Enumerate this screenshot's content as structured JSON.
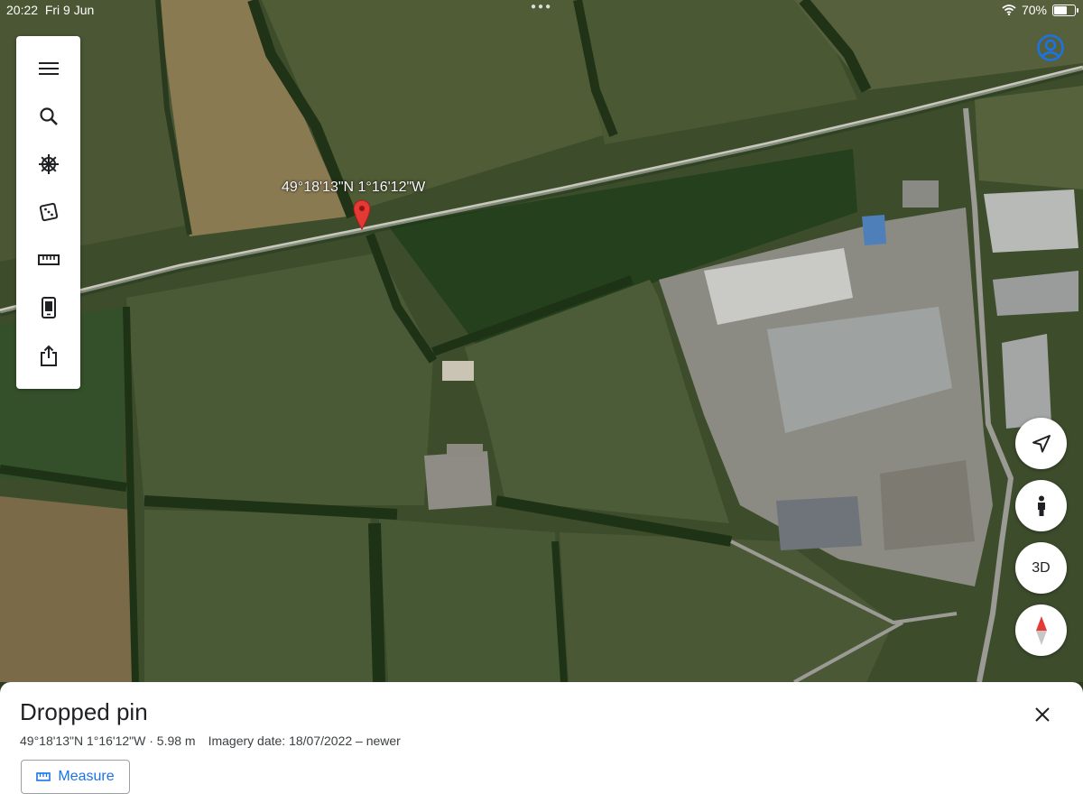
{
  "status": {
    "time": "20:22",
    "date": "Fri 9 Jun",
    "battery_pct": "70%",
    "battery_level": 0.7,
    "icons": [
      "wifi-icon",
      "battery-icon"
    ]
  },
  "toolbar": {
    "items": [
      {
        "name": "menu",
        "icon": "hamburger-menu-icon"
      },
      {
        "name": "search",
        "icon": "search-icon"
      },
      {
        "name": "voyager",
        "icon": "ships-wheel-icon"
      },
      {
        "name": "feeling-lucky",
        "icon": "dice-icon"
      },
      {
        "name": "measure",
        "icon": "ruler-icon"
      },
      {
        "name": "projects",
        "icon": "device-icon"
      },
      {
        "name": "share",
        "icon": "share-icon"
      }
    ]
  },
  "map": {
    "pin_label": "49°18'13\"N 1°16'12\"W",
    "pin_icon": "map-pin-icon",
    "pin_color": "#e53935"
  },
  "controls": {
    "three_d_label": "3D",
    "items": [
      "my-location-icon",
      "pegman-icon",
      "3d-toggle",
      "compass-icon"
    ]
  },
  "sheet": {
    "title": "Dropped pin",
    "coords": "49°18'13\"N 1°16'12\"W · 5.98 m",
    "imagery": "Imagery date: 18/07/2022 – newer",
    "measure_label": "Measure",
    "accent": "#1a73e8"
  }
}
